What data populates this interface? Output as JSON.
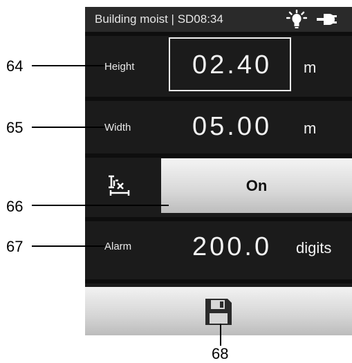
{
  "statusbar": {
    "title": "Building moist | SD08:34",
    "icons": [
      "bulb-icon",
      "plug-icon"
    ]
  },
  "fields": {
    "height": {
      "label": "Height",
      "value": "02.40",
      "unit": "m"
    },
    "width": {
      "label": "Width",
      "value": "05.00",
      "unit": "m"
    },
    "alarm": {
      "label": "Alarm",
      "value": "200.0",
      "unit": "digits"
    }
  },
  "toggle": {
    "label": "On",
    "icon": "range-icon"
  },
  "save": {
    "icon": "floppy-disk-save-icon"
  },
  "callouts": [
    "64",
    "65",
    "66",
    "67",
    "68"
  ],
  "colors": {
    "screen_bg": "#1b1b1b",
    "statusbar_bg": "#2a2a2a",
    "button_bg": "#d8d8d8",
    "text": "#f2f2f2"
  }
}
